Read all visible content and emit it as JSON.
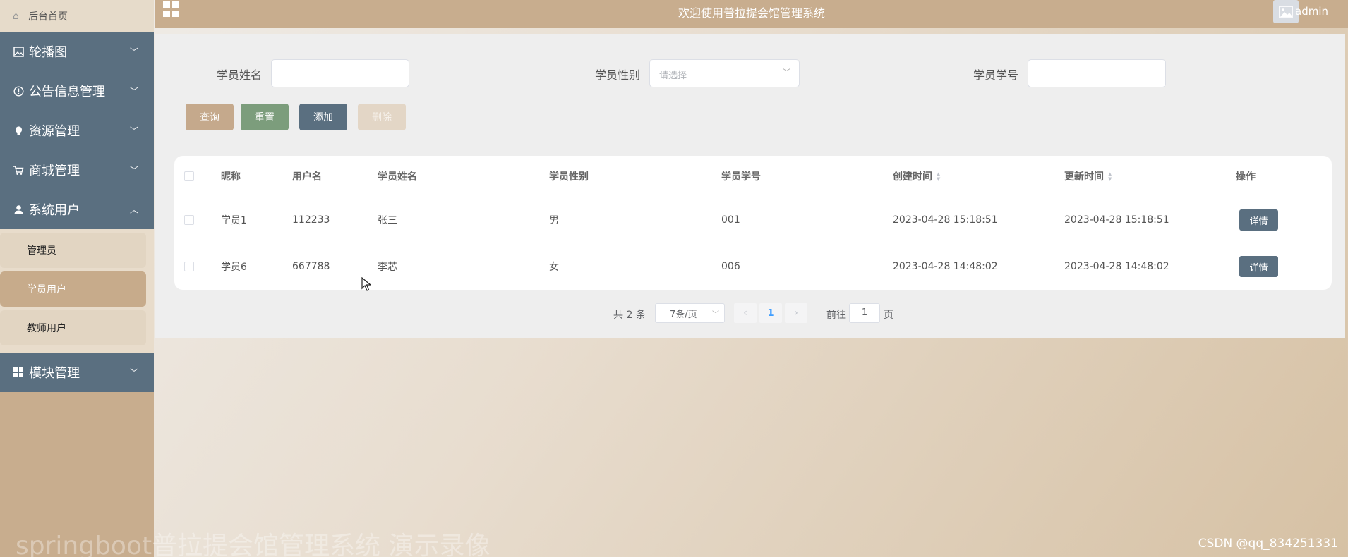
{
  "sidebar": {
    "home": "后台首页",
    "menus": [
      {
        "label": "轮播图",
        "icon": "image-icon"
      },
      {
        "label": "公告信息管理",
        "icon": "info-icon"
      },
      {
        "label": "资源管理",
        "icon": "lightbulb-icon"
      },
      {
        "label": "商城管理",
        "icon": "cart-icon"
      },
      {
        "label": "系统用户",
        "icon": "user-icon"
      },
      {
        "label": "模块管理",
        "icon": "grid-icon"
      }
    ],
    "submenu": [
      "管理员",
      "学员用户",
      "教师用户"
    ],
    "active_submenu": "学员用户"
  },
  "header": {
    "title": "欢迎使用普拉提会馆管理系统",
    "username": "admin"
  },
  "search": {
    "name_label": "学员姓名",
    "name_value": "",
    "gender_label": "学员性别",
    "gender_placeholder": "请选择",
    "number_label": "学员学号",
    "number_value": ""
  },
  "buttons": {
    "query": "查询",
    "reset": "重置",
    "add": "添加",
    "delete": "删除"
  },
  "table": {
    "columns": [
      "昵称",
      "用户名",
      "学员姓名",
      "学员性别",
      "学员学号",
      "创建时间",
      "更新时间",
      "操作"
    ],
    "rows": [
      {
        "nickname": "学员1",
        "username": "112233",
        "name": "张三",
        "gender": "男",
        "number": "001",
        "created": "2023-04-28 15:18:51",
        "updated": "2023-04-28 15:18:51",
        "action": "详情"
      },
      {
        "nickname": "学员6",
        "username": "667788",
        "name": "李芯",
        "gender": "女",
        "number": "006",
        "created": "2023-04-28 14:48:02",
        "updated": "2023-04-28 14:48:02",
        "action": "详情"
      }
    ]
  },
  "pagination": {
    "total": "共 2 条",
    "page_size": "7条/页",
    "current": "1",
    "goto_label": "前往",
    "goto_value": "1",
    "page_suffix": "页"
  },
  "watermark": {
    "left": "springboot普拉提会馆管理系统 演示录像",
    "right": "CSDN @qq_834251331"
  }
}
